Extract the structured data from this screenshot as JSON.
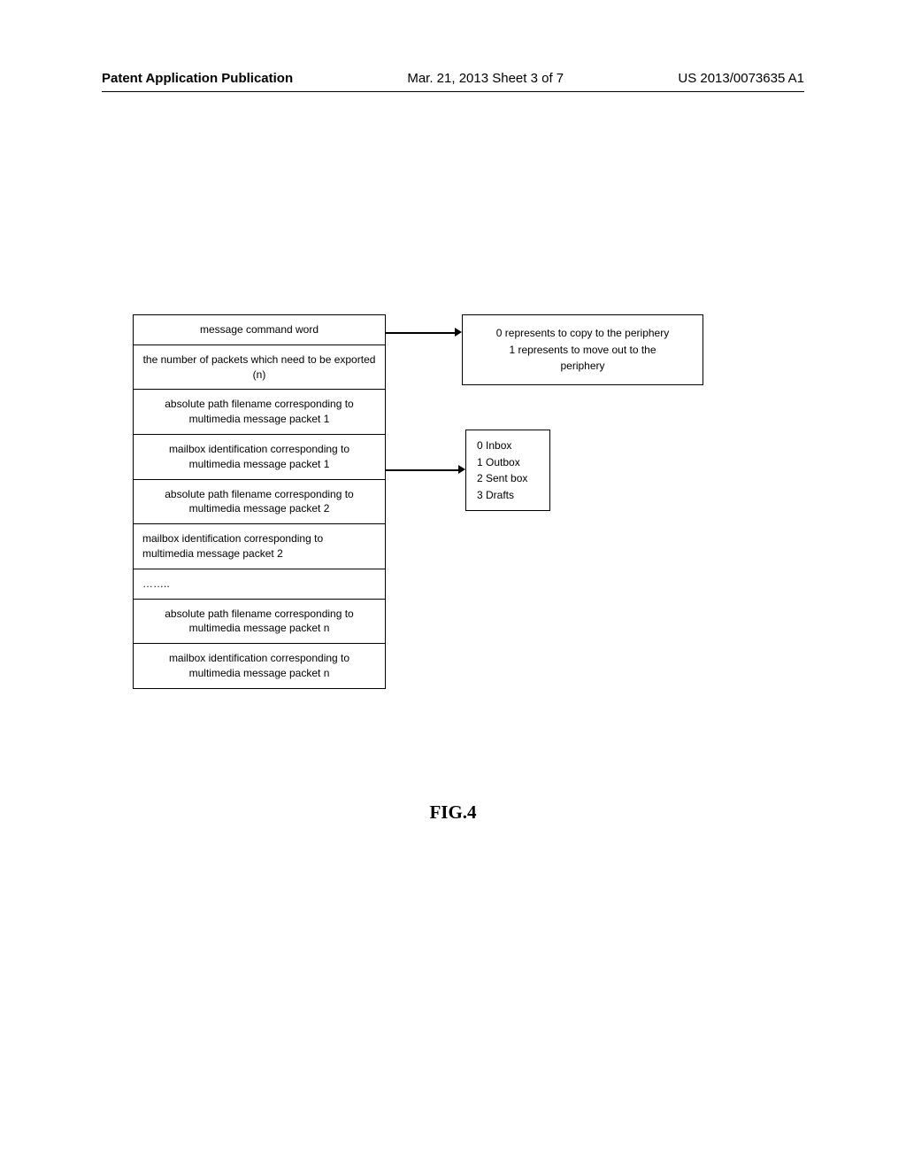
{
  "header": {
    "left": "Patent Application Publication",
    "center": "Mar. 21, 2013  Sheet 3 of 7",
    "right": "US 2013/0073635 A1"
  },
  "leftTable": {
    "cells": [
      "message command word",
      "the number of packets which need to be exported (n)",
      "absolute path filename corresponding to multimedia message packet 1",
      "mailbox identification corresponding to multimedia message packet 1",
      "absolute path filename corresponding to multimedia message packet 2",
      "mailbox identification corresponding to multimedia message packet 2",
      "……..",
      "absolute path filename corresponding to multimedia message packet n",
      "mailbox identification corresponding to multimedia message packet n"
    ]
  },
  "rightBoxTop": {
    "line1": "0 represents to copy to the periphery",
    "line2": "1 represents to move out to the",
    "line3": "periphery"
  },
  "rightBoxMiddle": {
    "line1": "0 Inbox",
    "line2": "1 Outbox",
    "line3": "2 Sent box",
    "line4": "3 Drafts"
  },
  "figureLabel": "FIG.4"
}
